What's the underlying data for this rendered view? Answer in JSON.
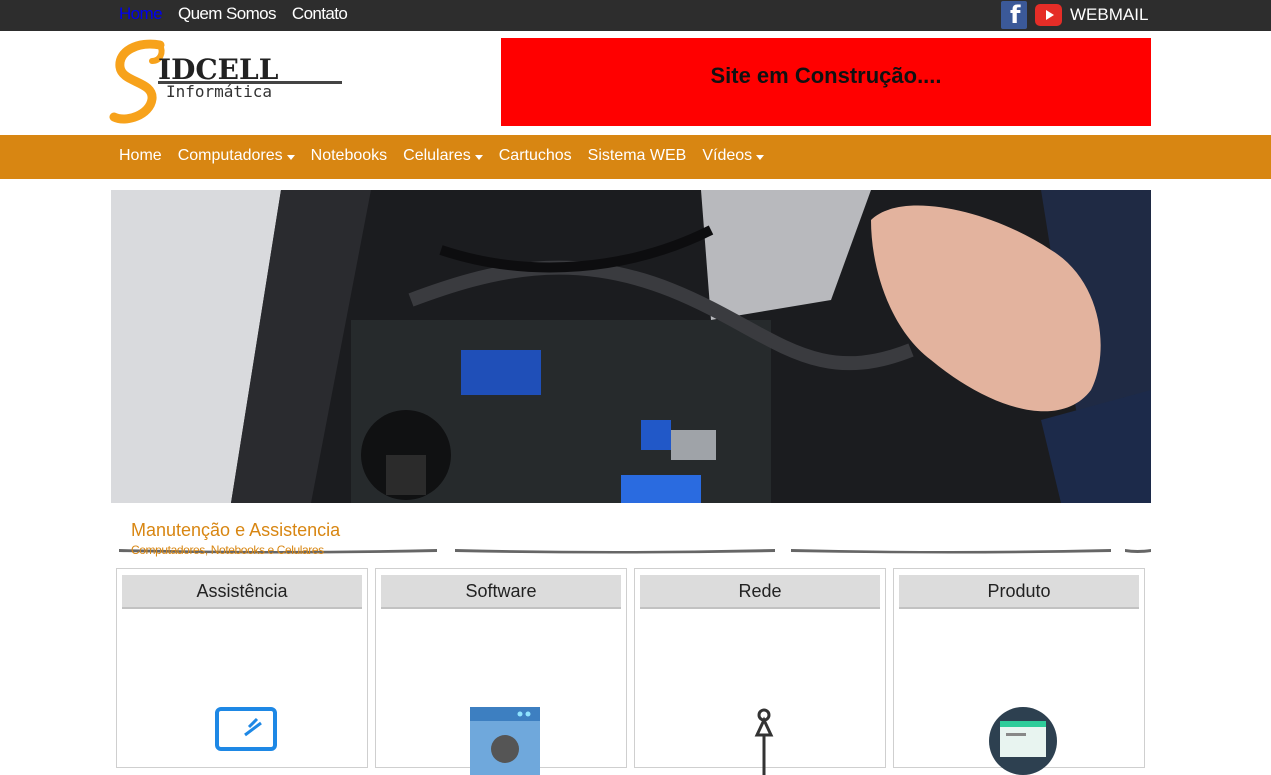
{
  "topbar": {
    "links": [
      {
        "label": "Home",
        "active": true
      },
      {
        "label": "Quem Somos",
        "active": false
      },
      {
        "label": "Contato",
        "active": false
      }
    ],
    "webmail_label": "WEBMAIL",
    "facebook_glyph": "f"
  },
  "logo": {
    "letter": "S",
    "brand": "IDCELL",
    "sub": "Informática"
  },
  "banner": {
    "text": "Site em Construção...."
  },
  "mainnav": {
    "items": [
      {
        "label": "Home",
        "dropdown": false
      },
      {
        "label": "Computadores",
        "dropdown": true
      },
      {
        "label": "Notebooks",
        "dropdown": false
      },
      {
        "label": "Celulares",
        "dropdown": true
      },
      {
        "label": "Cartuchos",
        "dropdown": false
      },
      {
        "label": "Sistema WEB",
        "dropdown": false
      },
      {
        "label": "Vídeos",
        "dropdown": true
      }
    ]
  },
  "section": {
    "title": "Manutenção e Assistencia",
    "subtitle": "Computadores, Notebooks e Celulares"
  },
  "cards": [
    {
      "title": "Assistência",
      "icon": "laptop-icon"
    },
    {
      "title": "Software",
      "icon": "browser-gear-icon"
    },
    {
      "title": "Rede",
      "icon": "network-icon"
    },
    {
      "title": "Produto",
      "icon": "web-globe-icon"
    }
  ],
  "colors": {
    "accent": "#d88612",
    "topbar": "#2d2d2d",
    "banner": "#ff0000",
    "active_link": "#0000ee"
  }
}
